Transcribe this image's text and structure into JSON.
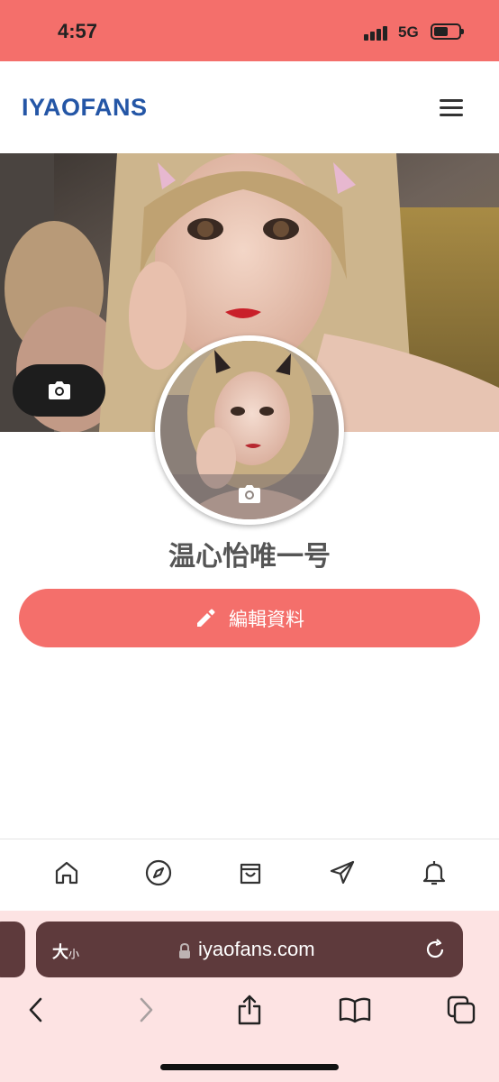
{
  "status_bar": {
    "time": "4:57",
    "network": "5G",
    "battery_level": 0.55
  },
  "header": {
    "logo": "IYAOFANS",
    "menu_icon": "hamburger-menu-icon"
  },
  "profile": {
    "name": "温心怡唯一号",
    "edit_label": "編輯資料",
    "cover_camera_icon": "camera-icon",
    "avatar_camera_icon": "camera-icon"
  },
  "bottom_nav": {
    "items": [
      {
        "icon": "home-icon"
      },
      {
        "icon": "compass-icon"
      },
      {
        "icon": "shopping-bag-icon"
      },
      {
        "icon": "send-icon"
      },
      {
        "icon": "bell-icon"
      }
    ]
  },
  "browser": {
    "text_size_label": "大",
    "text_size_small": "小",
    "url": "iyaofans.com",
    "toolbar": [
      "back-icon",
      "forward-icon",
      "share-icon",
      "bookmarks-icon",
      "tabs-icon"
    ]
  },
  "colors": {
    "accent": "#f46f6b",
    "logo": "#2456a6",
    "url_bar": "#5e3a3c",
    "browser_bg": "#fde3e3"
  }
}
